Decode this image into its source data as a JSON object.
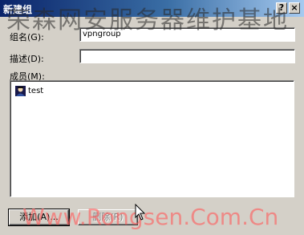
{
  "window": {
    "title": "新建组",
    "help_glyph": "?",
    "close_glyph": "×"
  },
  "form": {
    "group_name_label": "组名(G):",
    "group_name_value": "vpngroup",
    "description_label": "描述(D):",
    "description_value": "",
    "members_label": "成员(M):"
  },
  "members": [
    {
      "name": "test",
      "icon": "user-icon"
    }
  ],
  "buttons": {
    "add_label": "添加(A)...",
    "remove_label": "删除(R)"
  },
  "watermarks": {
    "top_text": "荣森网安服务器维护基地",
    "bottom_text": "Www.Rongsen.Com.Cn"
  }
}
